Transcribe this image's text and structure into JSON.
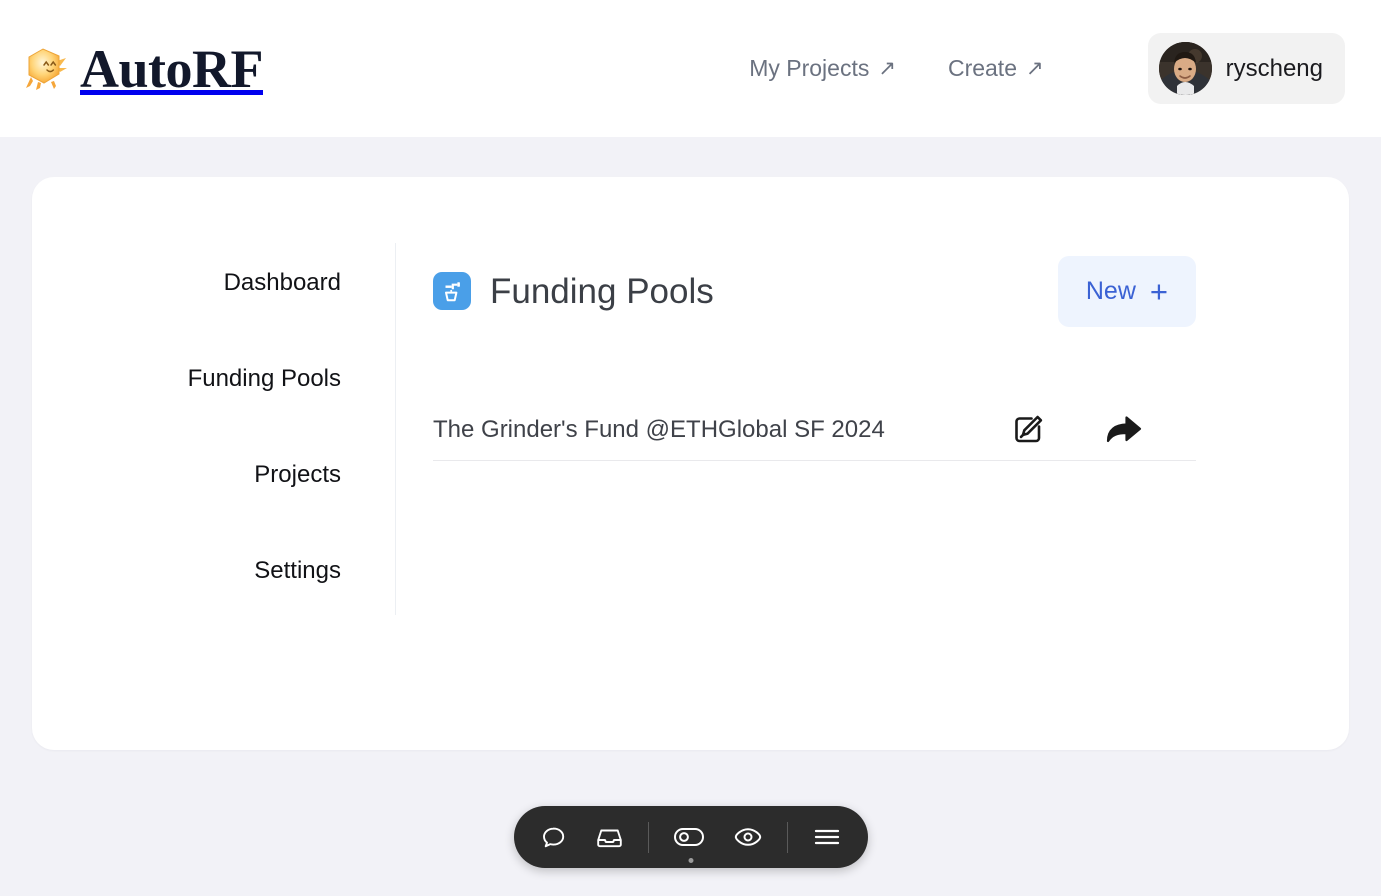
{
  "header": {
    "brand_name": "AutoRF",
    "logo_icon": "autorf-cube-mascot-logo",
    "nav": [
      {
        "label": "My Projects",
        "icon": "arrow-up-right-icon",
        "arrow": "↗"
      },
      {
        "label": "Create",
        "icon": "arrow-up-right-icon",
        "arrow": "↗"
      }
    ],
    "user": {
      "name": "ryscheng",
      "avatar_icon": "user-avatar-photo"
    }
  },
  "sidebar": {
    "items": [
      {
        "label": "Dashboard"
      },
      {
        "label": "Funding Pools"
      },
      {
        "label": "Projects"
      },
      {
        "label": "Settings"
      }
    ]
  },
  "main": {
    "title": "Funding Pools",
    "title_icon": "faucet-pouring-into-cup-icon",
    "new_button": {
      "label": "New",
      "plus": "+",
      "icon": "plus-icon"
    },
    "pools": [
      {
        "name": "The Grinder's Fund @ETHGlobal SF 2024",
        "edit_icon": "edit-pencil-square-icon",
        "share_icon": "share-forward-arrow-icon"
      }
    ]
  },
  "toolbar": {
    "buttons": [
      {
        "icon": "chat-bubble-icon",
        "name": "chat"
      },
      {
        "icon": "inbox-tray-icon",
        "name": "inbox"
      },
      {
        "icon": "toggle-switch-icon",
        "name": "toggle"
      },
      {
        "icon": "eye-icon",
        "name": "preview"
      },
      {
        "icon": "hamburger-menu-icon",
        "name": "menu"
      }
    ]
  },
  "colors": {
    "page_background": "#f2f2f7",
    "card_background": "#ffffff",
    "brand_text": "#12182b",
    "accent_blue": "#3b62d4",
    "new_button_bg": "#eef4fe",
    "pool_icon_bg": "#4a9fe8",
    "toolbar_bg": "#2c2c2c",
    "muted_text": "#6b7280"
  }
}
